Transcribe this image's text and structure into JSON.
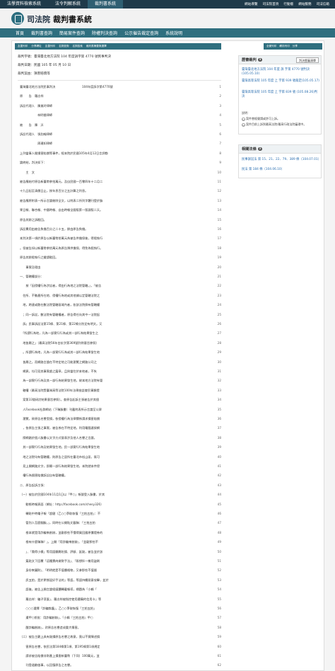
{
  "topbar": {
    "tabs": [
      "法學資料檢索系統",
      "法令判解系統",
      "裁判書系統"
    ],
    "links": [
      "網站導覽",
      "司法院首頁",
      "行動版",
      "網站服務",
      "司法信箱"
    ]
  },
  "header": {
    "org": "司法院",
    "system": "裁判書系統"
  },
  "nav": [
    "首頁",
    "裁判書查詢",
    "簡易案件查詢",
    "除權判決查詢",
    "公示催告裁定查詢",
    "系統說明"
  ],
  "toolbar": {
    "left": [
      "友善列印",
      "分享網址",
      "友善列印",
      "名詞查詢",
      "名詞檢索",
      "裁判書摘要與選擇"
    ],
    "right": [
      "全景列印",
      "轉存列印",
      "分享"
    ]
  },
  "meta": {
    "id": "裁判字號：臺灣臺北地方法院 104 年度訴字第 4770 號民事判決",
    "date": "裁判日期：民國 105 年 05 月 10 日",
    "cause": "裁判案由：損害賠償等"
  },
  "doc_lines": [
    {
      "t": "臺灣臺北地方法院民事判決　　　　　　　　　104年度訴字第4770號",
      "n": "1"
    },
    {
      "t": "原　　告　羅志祥",
      "n": "2"
    },
    {
      "t": "訴訟代理人　陳美玲律師",
      "n": "3"
    },
    {
      "t": "　　　　　　林明倫律師",
      "n": "4"
    },
    {
      "t": "被　　告　陳　沂",
      "n": "5"
    },
    {
      "t": "訴訟代理人　張鈞綸律師",
      "n": "6"
    },
    {
      "t": "　　　　　　周珊如律師",
      "n": "7"
    },
    {
      "t": "上列當事人間損害賠償等事件，經本院於民國105年4月12日言詞辯",
      "n": "8"
    },
    {
      "t": "論終結，判決如下：",
      "n": "9"
    },
    {
      "t": "　　主　文",
      "n": "10"
    },
    {
      "t": "被告應給付原告新臺幣參拾萬元，及自民國一百零四年十二月二",
      "n": "11"
    },
    {
      "t": "十九日起至清償日止，按年息百分之五計算之利息。",
      "n": "12"
    },
    {
      "t": "被告應將附表一所示言論刪除全文，以附表二所列字體刊登於臉",
      "n": "13"
    },
    {
      "t": "果日報、聯合報、中國時報、自由時報全國版第一版頭版二天。",
      "n": "14"
    },
    {
      "t": "原告其餘之訴駁回。",
      "n": "15"
    },
    {
      "t": "訴訟費用由被告負擔百分之二十五，餘由原告負擔。",
      "n": "16"
    },
    {
      "t": "本判決第一項於原告以新臺幣拾萬元為被告供擔保後，得假執行",
      "n": "17"
    },
    {
      "t": "。但被告如以新臺幣參拾萬元為原告預供擔保，得免為假執行。",
      "n": "18"
    },
    {
      "t": "原告其餘假執行之聲請駁回。",
      "n": "19"
    },
    {
      "t": "　　事實及理由",
      "n": "20"
    },
    {
      "t": "一、管轄權部分：",
      "n": "21"
    },
    {
      "t": "　　按「因侵權行為涉訟者，得由行為地之法院管轄。」，「被告",
      "n": "22"
    },
    {
      "t": "　住所、不動產所在地、侵權行為地或其他據以定管轄法院之",
      "n": "23"
    },
    {
      "t": "　地，跨連或散在數法院管轄區域內者，各該法院俱有管轄權",
      "n": "24"
    },
    {
      "t": "　；同一訴訟，數法院有管轄權者，原告得任向其中一法院起",
      "n": "25"
    },
    {
      "t": "　訴」民事訴訟法第15條、第21條、第22條分別定有明文。又",
      "n": "26"
    },
    {
      "t": "　「所謂行為地，凡為一部實行行為或其一部行為結果發生之",
      "n": "27"
    },
    {
      "t": "　地皆屬之」（最高法院56年台抗字第369號判例意旨參照）",
      "n": "28"
    },
    {
      "t": "　。所謂行為地，凡為一部實行行為或其一部行為結果發生地",
      "n": "29"
    },
    {
      "t": "　皆屬之，而網路言論在不特定地之可能瀏覽之網路公司之",
      "n": "30"
    },
    {
      "t": "　網頁，均可見其事實處之篇章，且與當住於本地者，不失",
      "n": "31"
    },
    {
      "t": "　為一部實行行為及其一部行為結果發生地，故本地方法院有管",
      "n": "32"
    },
    {
      "t": "　轄權（最高法院暨臺灣高等法院100年法律座談會民事類提",
      "n": "33"
    },
    {
      "t": "　案第33號研討結果意旨參照）。查原告起訴主張被告於其個",
      "n": "34"
    },
    {
      "t": "　人Facebook社群網站（下稱臉書）刊載附表所示言論至公眾",
      "n": "35"
    },
    {
      "t": "　瀏覽，致原告名譽受損，依侵權行為法律關係請求損害賠償",
      "n": "36"
    },
    {
      "t": "　，依原告主張之事實，被告係在不特定地，利用電腦連接網",
      "n": "37"
    },
    {
      "t": "　際網路於個人臉書以文字方式發表涉及他人名譽之言論，",
      "n": "38"
    },
    {
      "t": "　其一部實行行為及結果發生地，民一部實行行為結果發生地",
      "n": "39"
    },
    {
      "t": "　地之法院均有管轄權，則原告之居所在臺北市松山區，既可",
      "n": "40"
    },
    {
      "t": "　見上開網路文字，即屬一部行為結果發生地，本院就本件侵",
      "n": "41"
    },
    {
      "t": "　權行為損害賠償訴訟自有管轄權。",
      "n": "42"
    },
    {
      "t": "二、原告起訴主張：",
      "n": "43"
    },
    {
      "t": "（一）被告於民國104年11月1日以「甲○」帳號登入臉書，於其",
      "n": "44"
    },
    {
      "t": "　　動態時報頁面（網址：http://facebook.com/chesy326）",
      "n": "45"
    },
    {
      "t": "　　轉貼中時電子報「超健（乙○○爭取恢復「三拍五拍」：不",
      "n": "46"
    },
    {
      "t": "　　管別人怎麼翻臉，」，同時在公開貼文載稱：「三拍五拍",
      "n": "47"
    },
    {
      "t": "　　根本就是用詐騙來創辦，並勸那些不懂得買回國原價證券的",
      "n": "48"
    },
    {
      "t": "　　根有什麼稱稱？」，上開「用詐騙來創辦」、「並勸那些不",
      "n": "49"
    },
    {
      "t": "　　」、「貴得小模」等用語顯屬貶損、評斷、詆毀，被告並於該",
      "n": "50"
    },
    {
      "t": "　　篇貼文下回覆「這種賣肉做財手法」、「既想拌一樣用盜刷",
      "n": "51"
    },
    {
      "t": "　　身份來圖財」、「明明就是不值價格物，又拿那些不值錢",
      "n": "52"
    },
    {
      "t": "　　訊五拍，是於更撈混好手法的」等語，等語持續惡意攻擊，並於",
      "n": "53"
    },
    {
      "t": "　　語後，被告上開言論經媒體轉載報導，標題為「小賴「",
      "n": "54"
    },
    {
      "t": "　　羅志祥：騙子滾蛋」、羅志祥被指控使用遭竊的信用卡」等",
      "n": "55"
    },
    {
      "t": "　　○○○選擇「詐騙辯護」，乙○○爭取恢復「三拍五拍」",
      "n": "56"
    },
    {
      "t": "　　遭甲○怒批：用詐騙創辦」，「小賴『三拍五拍』甲○",
      "n": "57"
    },
    {
      "t": "　　酸詐騙創辦」，對原告名譽造成重大傷害。",
      "n": "58"
    },
    {
      "t": "（二）被告主觀上具有毀損原告名譽之故意，竟以不實陳述損",
      "n": "59"
    },
    {
      "t": "　　害原告名譽，依民法第184條第1項、第195條第1項規定",
      "n": "60"
    },
    {
      "t": "　　請求被告賠償非財產上損害新臺幣（下同）100萬元，並",
      "n": "61"
    },
    {
      "t": "　　刊登道歉啟事，以回復原告之名譽。",
      "n": "62"
    }
  ],
  "panel1": {
    "title": "歷審裁判",
    "count": "3",
    "button": "判決歷審清單",
    "items": [
      "臺灣臺北地方法院 104 年度 訴 字第 4770 號判決(105.05.10)",
      "臺灣高等法院 105 年度 上 字第 939 號裁定(105.05.17)",
      "臺灣高等法院 105 年度 上 字第 839 號 (105.08.26)判決"
    ],
    "note_title": "說明：",
    "notes": [
      "案件曾經聲請或許可上訴。",
      "案件目前上訴到最高法院/最高行政法院審理中。"
    ]
  },
  "panel2": {
    "title": "相關法條",
    "count": "2",
    "items": [
      "民事訴訟法 第 15、21、22、79、389 條（104.07.01）",
      "民法 第 184 條（104.06.10）"
    ]
  }
}
